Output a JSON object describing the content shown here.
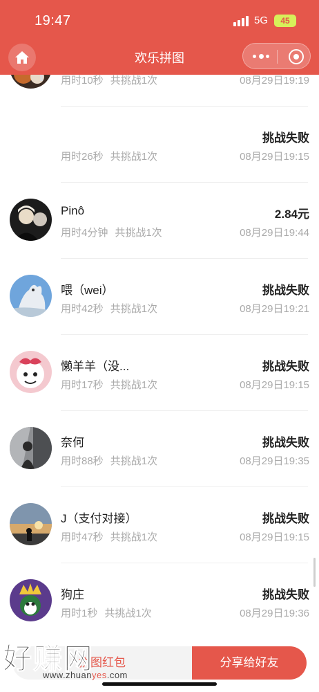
{
  "status_bar": {
    "time": "19:47",
    "network": "5G",
    "battery": "45"
  },
  "nav": {
    "title": "欢乐拼图"
  },
  "rows": [
    {
      "name": "",
      "time_label": "用时10秒",
      "count_label": "共挑战1次",
      "result": "",
      "datetime": "08月29日19:19"
    },
    {
      "name": "",
      "time_label": "用时26秒",
      "count_label": "共挑战1次",
      "result": "挑战失败",
      "datetime": "08月29日19:15"
    },
    {
      "name": "Pinô",
      "time_label": "用时4分钟",
      "count_label": "共挑战1次",
      "result": "2.84元",
      "datetime": "08月29日19:44"
    },
    {
      "name": "喂（wei）",
      "time_label": "用时42秒",
      "count_label": "共挑战1次",
      "result": "挑战失败",
      "datetime": "08月29日19:21"
    },
    {
      "name": "懒羊羊（没...",
      "time_label": "用时17秒",
      "count_label": "共挑战1次",
      "result": "挑战失败",
      "datetime": "08月29日19:15"
    },
    {
      "name": "奈何",
      "time_label": "用时88秒",
      "count_label": "共挑战1次",
      "result": "挑战失败",
      "datetime": "08月29日19:35"
    },
    {
      "name": "J（支付对接）",
      "time_label": "用时47秒",
      "count_label": "共挑战1次",
      "result": "挑战失败",
      "datetime": "08月29日19:15"
    },
    {
      "name": "狗庄",
      "time_label": "用时1秒",
      "count_label": "共挑战1次",
      "result": "挑战失败",
      "datetime": "08月29日19:36"
    }
  ],
  "bottom": {
    "left_button": "拼图红包",
    "right_button": "分享给好友"
  },
  "watermark": {
    "brand": "好赚网",
    "url_prefix": "www.zhuan",
    "url_accent": "yes",
    "url_suffix": ".com"
  },
  "colors": {
    "brand": "#e5574b",
    "muted_text": "#aaaaaa",
    "battery": "#d7f05a"
  }
}
